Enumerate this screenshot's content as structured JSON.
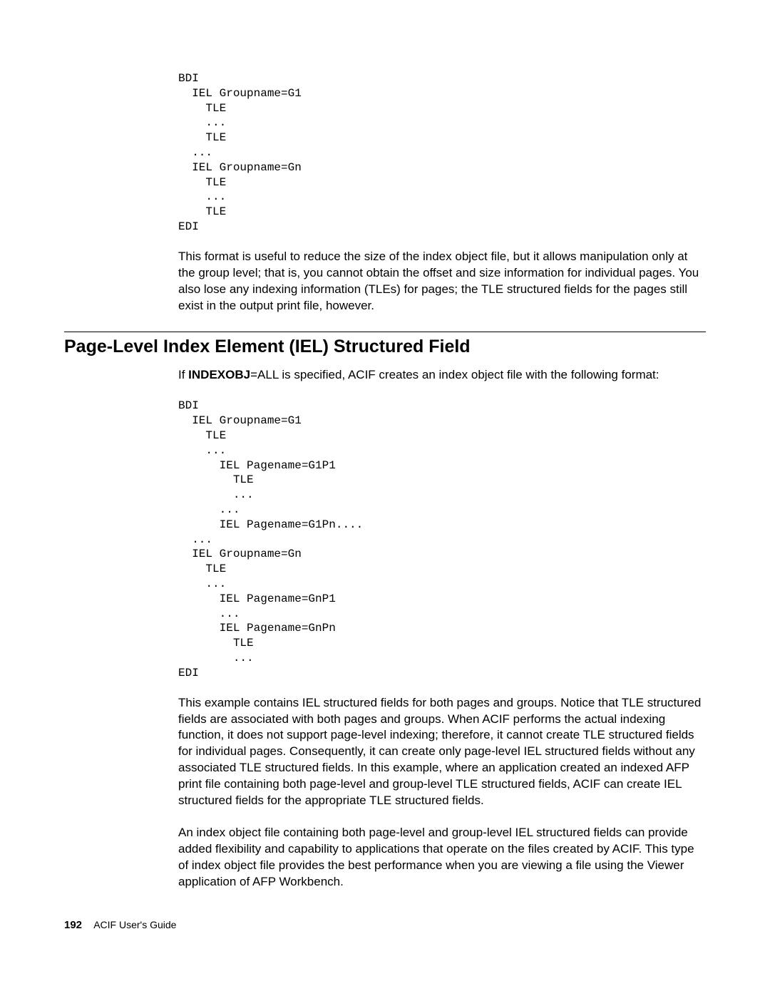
{
  "code1": "BDI\n  IEL Groupname=G1\n    TLE\n    ...\n    TLE\n  ...\n  IEL Groupname=Gn\n    TLE\n    ...\n    TLE\nEDI",
  "para1": "This format is useful to reduce the size of the index object file, but it allows manipulation only at the group level; that is, you cannot obtain the offset and size information for individual pages. You also lose any indexing information (TLEs) for pages; the TLE structured fields for the pages still exist in the output print file, however.",
  "heading": "Page-Level Index Element (IEL) Structured Field",
  "intro_prefix": "If ",
  "intro_bold": "INDEXOBJ",
  "intro_suffix": "=ALL is specified, ACIF creates an index object file with the following format:",
  "code2": "BDI\n  IEL Groupname=G1\n    TLE\n    ...\n      IEL Pagename=G1P1\n        TLE\n        ...\n      ...\n      IEL Pagename=G1Pn....\n  ...\n  IEL Groupname=Gn\n    TLE\n    ...\n      IEL Pagename=GnP1\n      ...\n      IEL Pagename=GnPn\n        TLE\n        ...\nEDI",
  "para2": "This example contains IEL structured fields for both pages and groups.  Notice that TLE structured fields are associated with both pages and groups.  When ACIF performs the actual indexing function, it does not support page-level indexing; therefore, it cannot create TLE structured fields for individual pages. Consequently, it can create only page-level IEL structured fields without any associated TLE structured fields. In this example, where an application created an indexed AFP print file containing both page-level and group-level TLE structured fields, ACIF can create IEL structured fields for the appropriate TLE structured fields.",
  "para3": "An index object file containing both page-level and group-level IEL structured fields can provide added flexibility and capability to applications that operate on the files created by ACIF. This type of index object file provides the best performance when you are viewing a file using the Viewer application of AFP Workbench.",
  "footer": {
    "pagenum": "192",
    "text": "ACIF User's Guide"
  }
}
